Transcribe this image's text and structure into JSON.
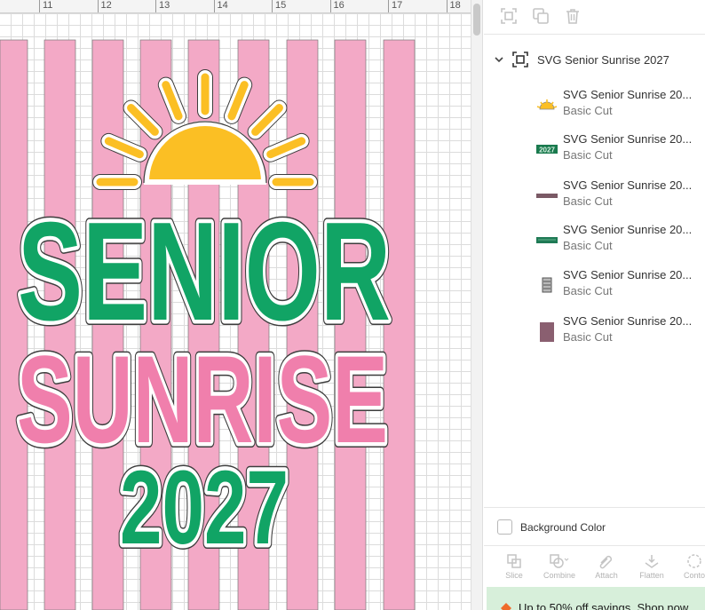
{
  "ruler": {
    "ticks": [
      "11",
      "12",
      "13",
      "14",
      "15",
      "16",
      "17",
      "18"
    ]
  },
  "artwork": {
    "line1": "SENIOR",
    "line2": "SUNRISE",
    "line3": "2027",
    "colors": {
      "stripe": "#f3a9c6",
      "green": "#11a465",
      "pink": "#f07fac",
      "sun": "#fbbf24",
      "outline": "#3d3d3d"
    }
  },
  "panel": {
    "toolbar": {
      "icons": [
        "group-icon",
        "duplicate-icon",
        "delete-icon"
      ]
    },
    "group": {
      "name": "SVG Senior Sunrise 2027",
      "expanded": true
    },
    "layers": [
      {
        "name": "SVG Senior Sunrise 20...",
        "operation": "Basic Cut",
        "thumb": "sun-thumbnail"
      },
      {
        "name": "SVG Senior Sunrise 20...",
        "operation": "Basic Cut",
        "thumb": "year-thumbnail"
      },
      {
        "name": "SVG Senior Sunrise 20...",
        "operation": "Basic Cut",
        "thumb": "outline-thumbnail"
      },
      {
        "name": "SVG Senior Sunrise 20...",
        "operation": "Basic Cut",
        "thumb": "text-thumbnail"
      },
      {
        "name": "SVG Senior Sunrise 20...",
        "operation": "Basic Cut",
        "thumb": "design-thumbnail"
      },
      {
        "name": "SVG Senior Sunrise 20...",
        "operation": "Basic Cut",
        "thumb": "rectangle-thumbnail"
      }
    ],
    "background_color_label": "Background Color",
    "actions": [
      "Slice",
      "Combine",
      "Attach",
      "Flatten",
      "Conto"
    ],
    "promo": "Up to 50% off savings. Shop now"
  }
}
